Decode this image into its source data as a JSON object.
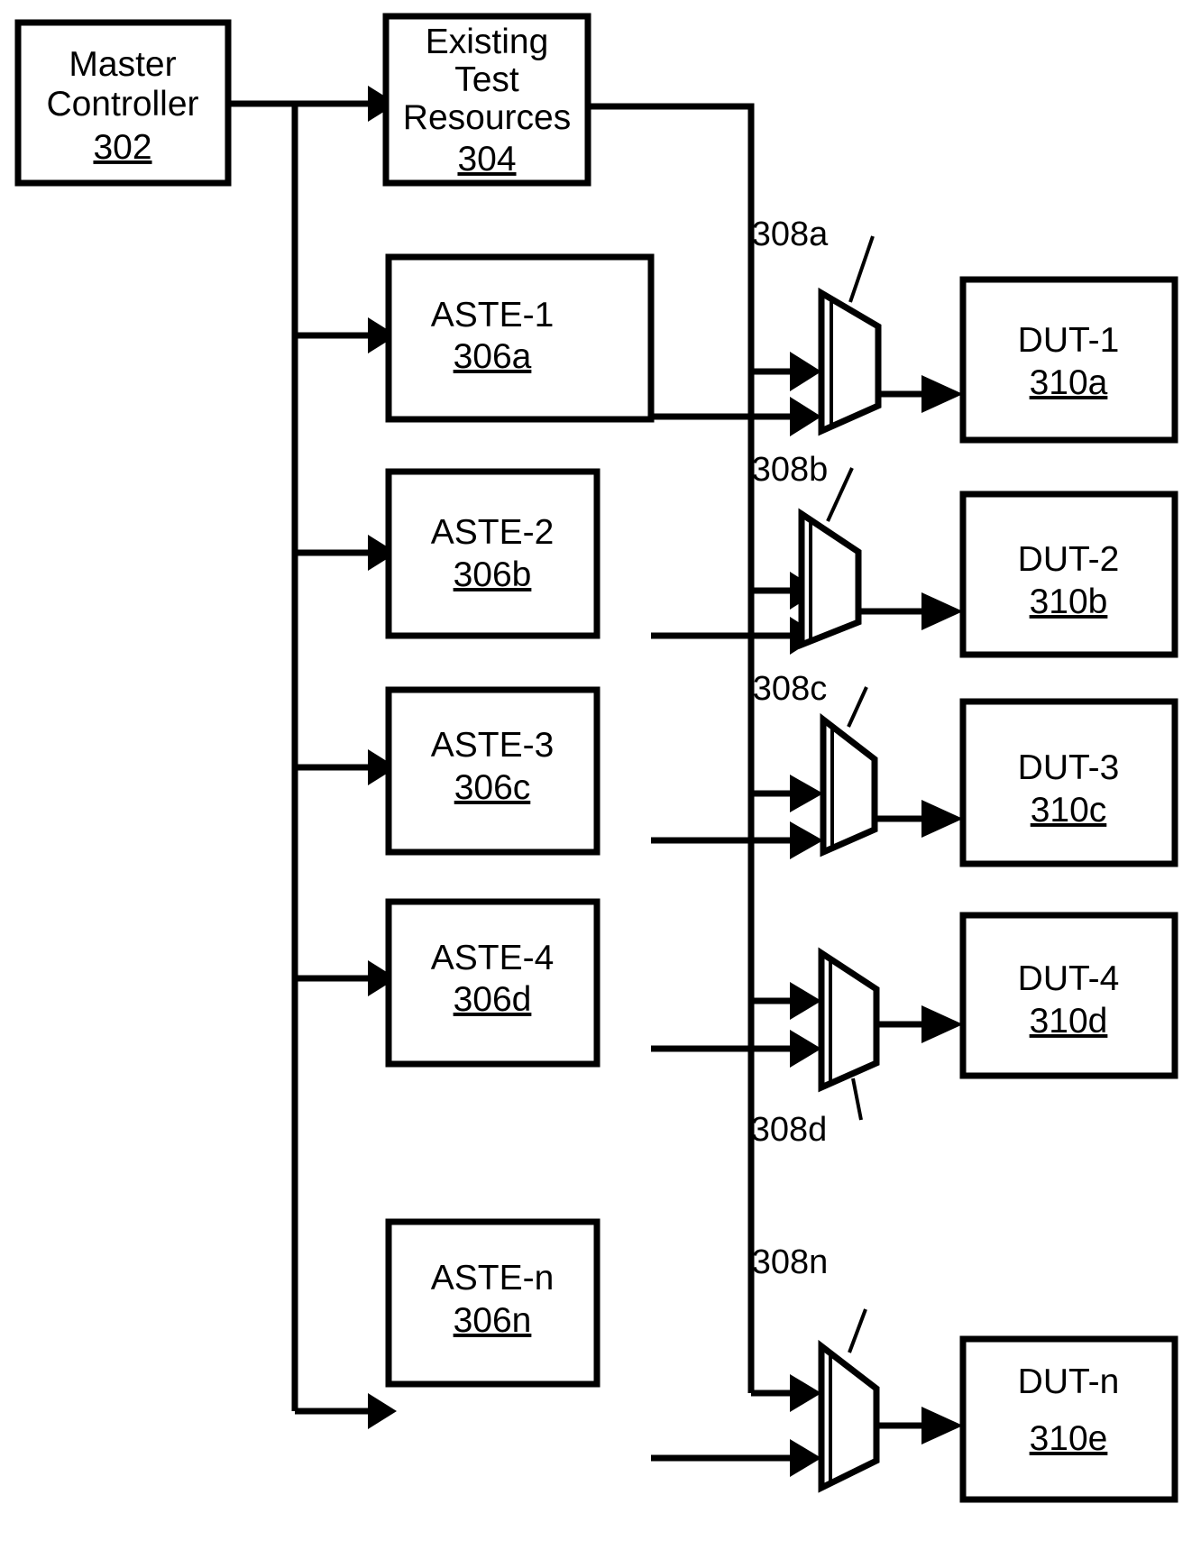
{
  "figure": {
    "type": "block-diagram",
    "description": "Automated test system block diagram with master controller, existing test resources, ASTE blocks, multiplexers and DUT blocks"
  },
  "blocks": {
    "master_controller": {
      "line1": "Master",
      "line2": "Controller",
      "ref": "302"
    },
    "existing_test_resources": {
      "line1": "Existing",
      "line2": "Test",
      "line3": "Resources",
      "ref": "304"
    },
    "aste": [
      {
        "label": "ASTE-1",
        "ref": "306a"
      },
      {
        "label": "ASTE-2",
        "ref": "306b"
      },
      {
        "label": "ASTE-3",
        "ref": "306c"
      },
      {
        "label": "ASTE-4",
        "ref": "306d"
      },
      {
        "label": "ASTE-n",
        "ref": "306n"
      }
    ],
    "mux": [
      {
        "ref": "308a",
        "label_position": "above"
      },
      {
        "ref": "308b",
        "label_position": "above"
      },
      {
        "ref": "308c",
        "label_position": "above"
      },
      {
        "ref": "308d",
        "label_position": "below"
      },
      {
        "ref": "308n",
        "label_position": "above"
      }
    ],
    "dut": [
      {
        "label": "DUT-1",
        "ref": "310a"
      },
      {
        "label": "DUT-2",
        "ref": "310b"
      },
      {
        "label": "DUT-3",
        "ref": "310c"
      },
      {
        "label": "DUT-4",
        "ref": "310d"
      },
      {
        "label": "DUT-n",
        "ref": "310e"
      }
    ]
  },
  "colors": {
    "stroke": "#000000",
    "fill": "#ffffff",
    "background": "#ffffff"
  }
}
